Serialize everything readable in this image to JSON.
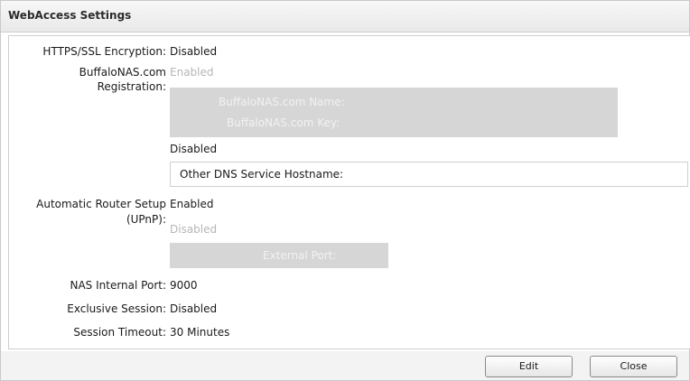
{
  "window": {
    "title": "WebAccess Settings"
  },
  "settings": {
    "https_label": "HTTPS/SSL Encryption:",
    "https_value": "Disabled",
    "buffalo_label_line1": "BuffaloNAS.com",
    "buffalo_label_line2": "Registration:",
    "buffalo_option_enabled": "Enabled",
    "buffalo_name_label": "BuffaloNAS.com Name:",
    "buffalo_key_label": "BuffaloNAS.com Key:",
    "buffalo_option_disabled": "Disabled",
    "other_dns_label": "Other DNS Service Hostname:",
    "upnp_label_line1": "Automatic Router Setup",
    "upnp_label_line2": "(UPnP):",
    "upnp_value": "Enabled",
    "upnp_sub_disabled": "Disabled",
    "external_port_label": "External Port:",
    "internal_port_label": "NAS Internal Port:",
    "internal_port_value": "9000",
    "exclusive_label": "Exclusive Session:",
    "exclusive_value": "Disabled",
    "timeout_label": "Session Timeout:",
    "timeout_value": "30 Minutes"
  },
  "buttons": {
    "edit": "Edit",
    "close": "Close"
  }
}
